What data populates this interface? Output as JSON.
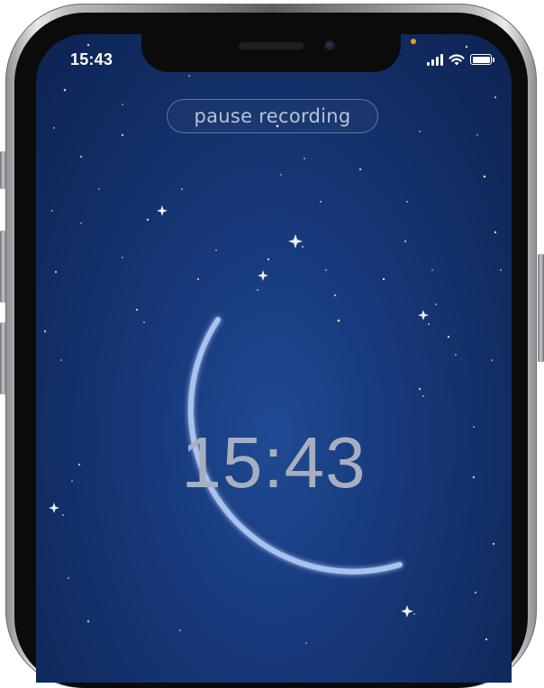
{
  "status_bar": {
    "time": "15:43",
    "icons": [
      "cellular-signal-icon",
      "wifi-icon",
      "battery-icon"
    ],
    "battery_level": 1.0,
    "privacy_indicator_color": "#f39b1d"
  },
  "recording": {
    "pause_label": "pause recording",
    "clock_time": "15:43",
    "arc_progress_fraction": 0.5
  },
  "colors": {
    "background_center": "#1f4a93",
    "background_edge": "#0d2352",
    "arc": "#a9c2ee",
    "clock_text": "#a7afbf",
    "button_text": "#b7c3d9"
  }
}
